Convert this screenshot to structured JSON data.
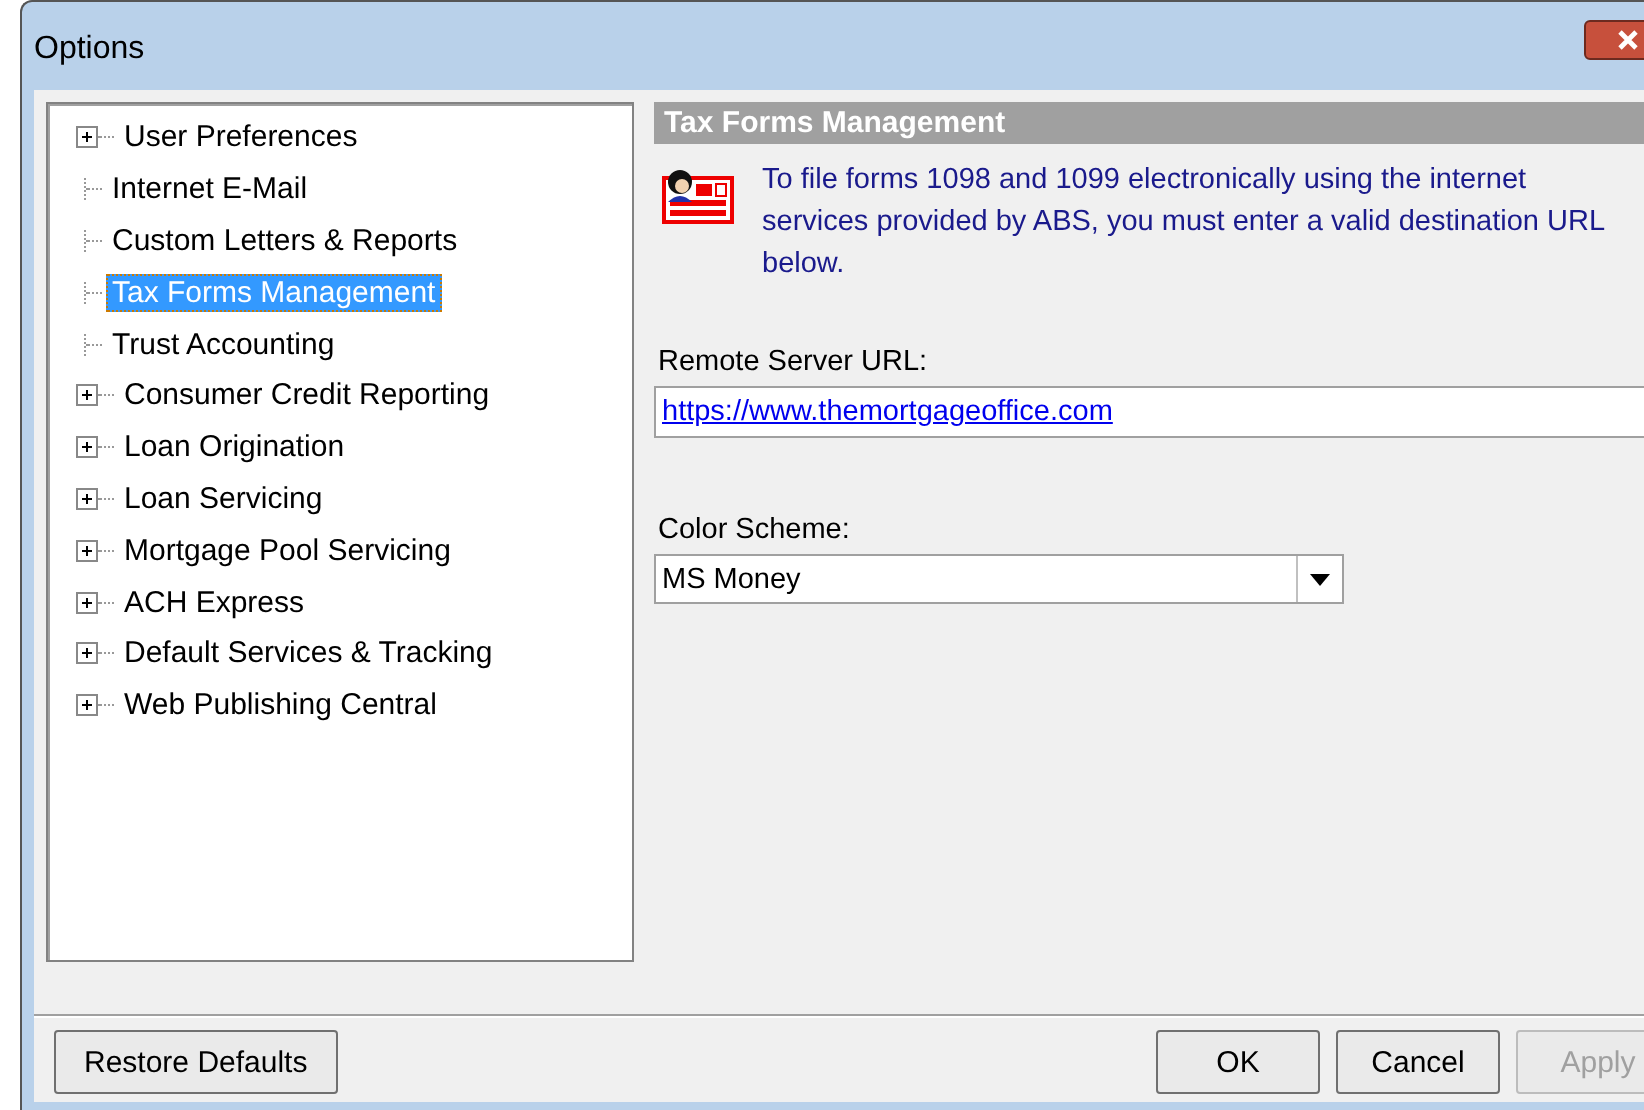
{
  "window": {
    "title": "Options"
  },
  "tree": {
    "items": [
      {
        "label": "User Preferences",
        "expandable": true,
        "selected": false
      },
      {
        "label": "Internet E-Mail",
        "expandable": false,
        "selected": false
      },
      {
        "label": "Custom Letters & Reports",
        "expandable": false,
        "selected": false
      },
      {
        "label": "Tax Forms Management",
        "expandable": false,
        "selected": true
      },
      {
        "label": "Trust Accounting",
        "expandable": false,
        "selected": false
      },
      {
        "label": "Consumer Credit Reporting",
        "expandable": true,
        "selected": false
      },
      {
        "label": "Loan Origination",
        "expandable": true,
        "selected": false
      },
      {
        "label": "Loan Servicing",
        "expandable": true,
        "selected": false
      },
      {
        "label": "Mortgage Pool Servicing",
        "expandable": true,
        "selected": false
      },
      {
        "label": "ACH Express",
        "expandable": true,
        "selected": false
      },
      {
        "label": "Default Services & Tracking",
        "expandable": true,
        "selected": false
      },
      {
        "label": "Web Publishing Central",
        "expandable": true,
        "selected": false
      }
    ]
  },
  "panel": {
    "heading": "Tax Forms Management",
    "description": "To file forms 1098 and 1099 electronically using the internet services provided by ABS, you must enter a valid destination URL below.",
    "url_label": "Remote Server URL:",
    "url_value": "https://www.themortgageoffice.com",
    "scheme_label": "Color Scheme:",
    "scheme_value": "MS Money"
  },
  "buttons": [
    {
      "label": "Restore Defaults",
      "disabled": false
    },
    {
      "label": "OK",
      "disabled": false
    },
    {
      "label": "Cancel",
      "disabled": false
    },
    {
      "label": "Apply",
      "disabled": true
    }
  ]
}
